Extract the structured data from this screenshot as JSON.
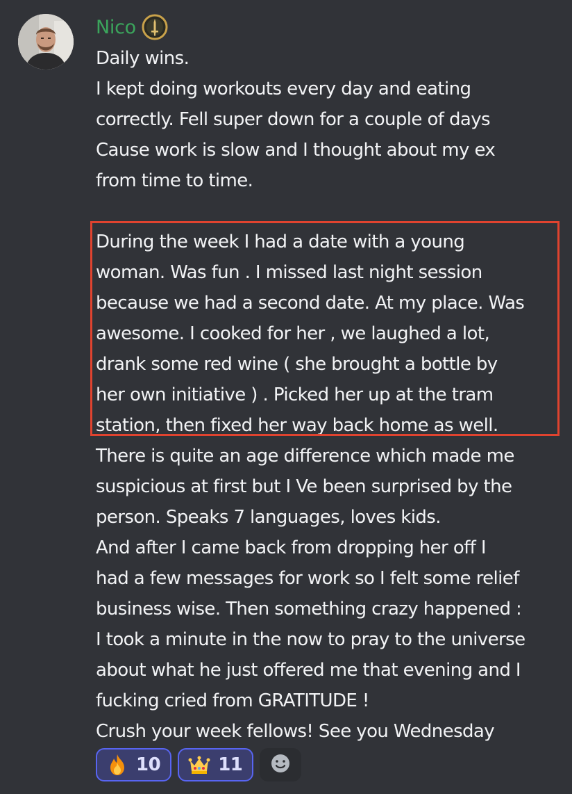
{
  "message": {
    "author": "Nico",
    "author_color": "#3ba55c",
    "role_icon": "dagger-badge-icon",
    "lines": [
      "Daily wins.",
      "I kept doing workouts every day and eating",
      "correctly. Fell super down for a couple of days",
      "Cause work is slow and I thought about my ex",
      "from time to time.",
      "",
      "During the week I had a date with a young",
      "woman. Was fun . I missed last night session",
      "because we had a second date. At my place. Was",
      "awesome. I cooked for her , we laughed a lot,",
      "drank some red wine ( she brought a bottle by",
      "her own initiative ) . Picked her up at the tram",
      "station, then fixed her way back home as well.",
      "There is quite an age difference which made me",
      "suspicious at first but I Ve been surprised by the",
      "person. Speaks 7 languages, loves kids.",
      "And after I came back from dropping her off I",
      "had a few messages for work so I felt some relief",
      "business wise. Then something crazy happened :",
      "I took a minute in the now  to pray to the universe",
      "about what he just offered me that evening and I",
      "fucking cried from GRATITUDE !",
      "Crush your week fellows! See you Wednesday"
    ],
    "highlight_color": "#e0432f"
  },
  "reactions": [
    {
      "emoji": "fire-emoji-icon",
      "count": "10"
    },
    {
      "emoji": "crown-emoji-icon",
      "count": "11"
    }
  ],
  "add_reaction_icon": "smiley-add-reaction-icon",
  "colors": {
    "background": "#313338",
    "reaction_border": "#5865f2",
    "reaction_bg": "#3b3e6e"
  }
}
